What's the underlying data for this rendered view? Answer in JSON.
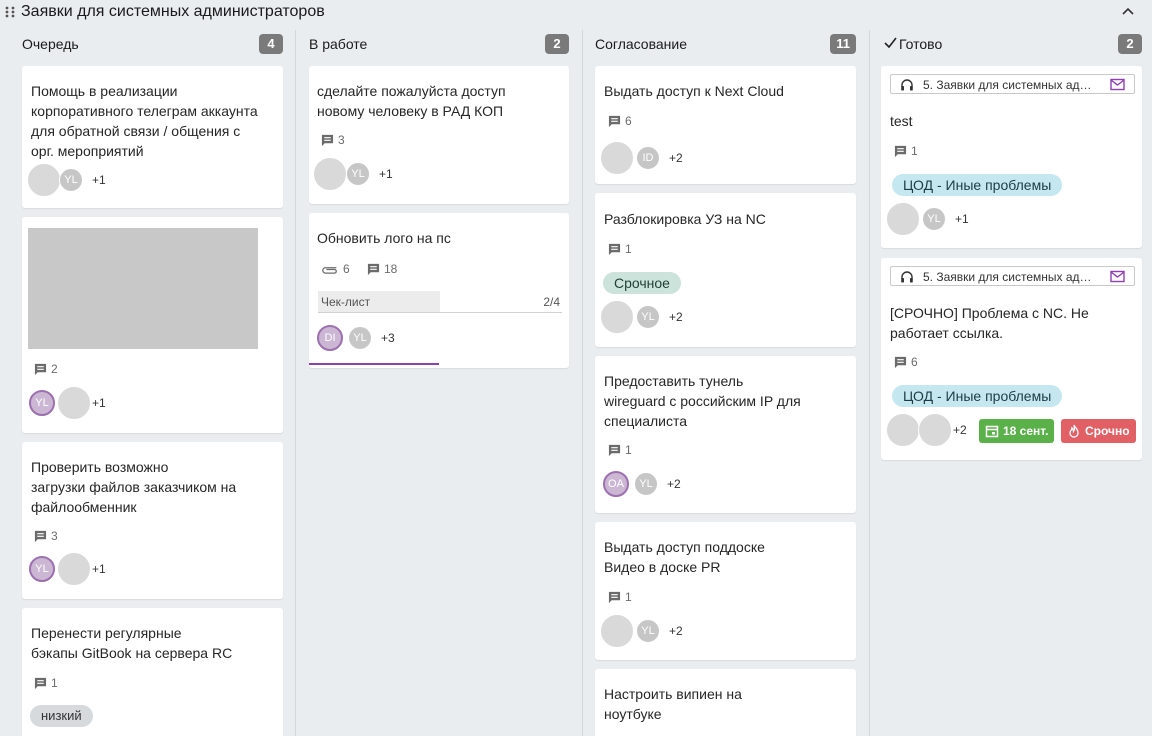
{
  "board": {
    "title": "Заявки для системных администраторов"
  },
  "columns": [
    {
      "title": "Очередь",
      "count": "4"
    },
    {
      "title": "В работе",
      "count": "2"
    },
    {
      "title": "Согласование",
      "count": "11"
    },
    {
      "title": "Готово",
      "count": "2"
    }
  ],
  "queue": [
    {
      "title": [
        "Помощь в реализации",
        "корпоративного телеграм аккаунта",
        "для обратной связи / общения с",
        "орг. мероприятий"
      ],
      "avatar": "YL",
      "more": "+1"
    },
    {
      "comments": "2",
      "avatar": "YL",
      "more": "+1"
    },
    {
      "title": [
        "Проверить возможно",
        "загрузки файлов заказчиком на",
        "файлообменник"
      ],
      "comments": "3",
      "avatar": "YL",
      "more": "+1"
    },
    {
      "title": [
        "Перенести регулярные",
        "бэкапы GitBook на сервера RC"
      ],
      "comments": "1",
      "tag": "низкий"
    }
  ],
  "work": [
    {
      "title": [
        "сделайте пожалуйста доступ",
        "новому человеку в РАД КОП"
      ],
      "comments": "3",
      "avatar": "YL",
      "more": "+1"
    },
    {
      "title": [
        "Обновить лого на пс"
      ],
      "attachments": "6",
      "comments": "18",
      "checklist_label": "Чек-лист",
      "checklist_count": "2/4",
      "checklist_progress": 0.5,
      "avatar1": "DI",
      "avatar2": "YL",
      "more": "+3"
    }
  ],
  "approval": [
    {
      "title": [
        "Выдать доступ к Next Cloud"
      ],
      "comments": "6",
      "avatar": "ID",
      "more": "+2"
    },
    {
      "title": [
        "Разблокировка УЗ на NC"
      ],
      "comments": "1",
      "tag": "Срочное",
      "avatar": "YL",
      "more": "+2"
    },
    {
      "title": [
        "Предоставить тунель",
        "wireguard с российским IP для",
        "специалиста"
      ],
      "comments": "1",
      "avatar1": "OA",
      "avatar2": "YL",
      "more": "+2"
    },
    {
      "title": [
        "Выдать доступ поддоске",
        "Видео в доске PR"
      ],
      "comments": "1",
      "avatar": "YL",
      "more": "+2"
    },
    {
      "title": [
        "Настроить випиен на",
        "ноутбуке"
      ]
    }
  ],
  "done": [
    {
      "source": "5. Заявки для системных ад…",
      "title": [
        "test"
      ],
      "comments": "1",
      "tag": "ЦОД - Иные проблемы",
      "avatar": "YL",
      "more": "+1"
    },
    {
      "source": "5. Заявки для системных ад…",
      "title": [
        "[СРОЧНО] Проблема с NC. Не",
        "работает ссылка."
      ],
      "comments": "6",
      "tag": "ЦОД - Иные проблемы",
      "more": "+2",
      "date": "18 сент.",
      "urgent": "Срочно"
    }
  ],
  "colors": {
    "accent": "#8e3fb0",
    "date": "#5ab14a",
    "urgent": "#e06066"
  }
}
